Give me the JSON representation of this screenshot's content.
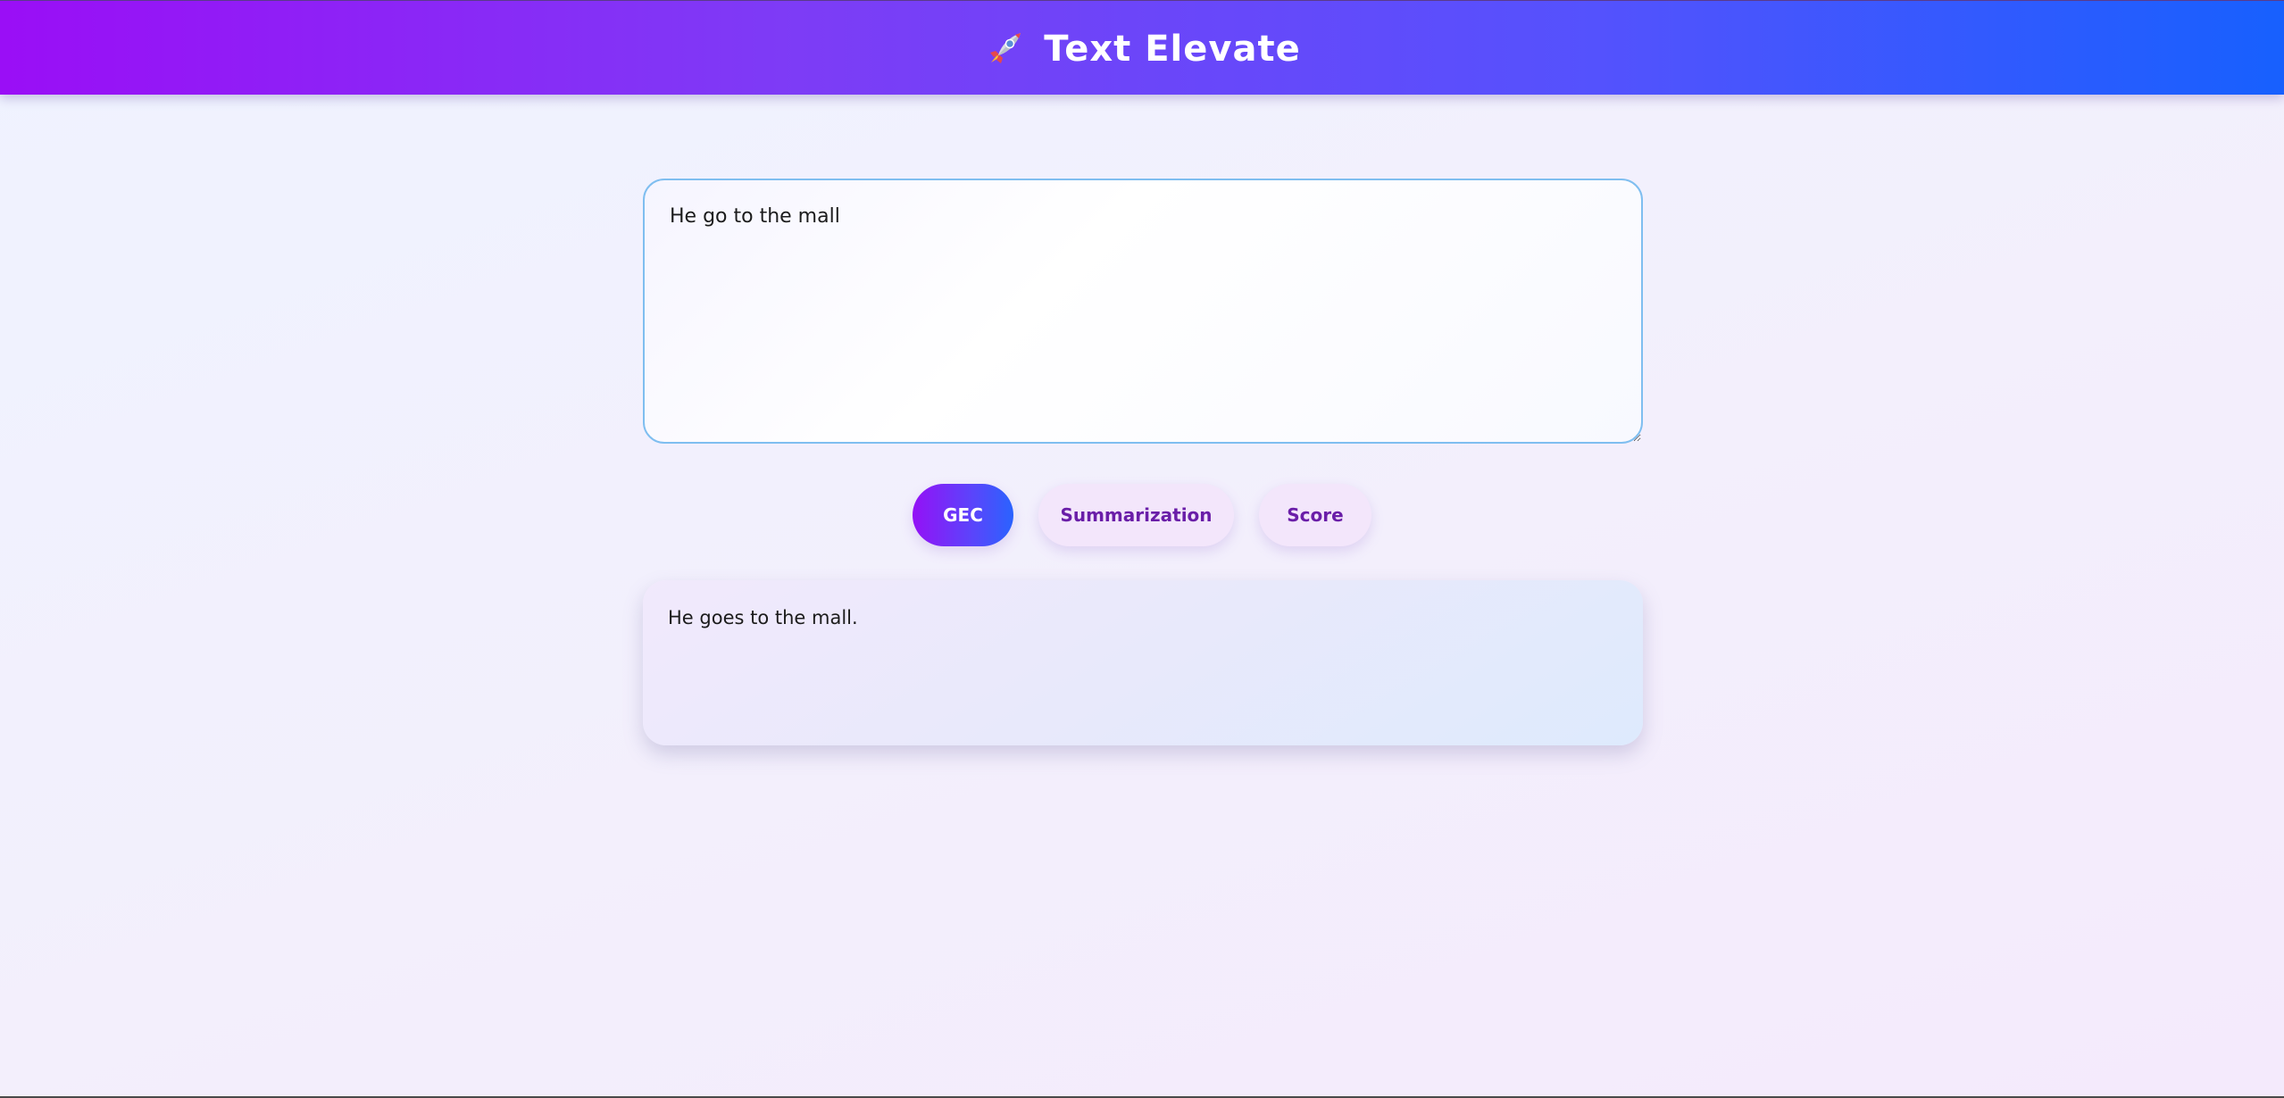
{
  "header": {
    "title": "Text Elevate",
    "icon": "rocket-icon"
  },
  "editor": {
    "value": "He go to the mall"
  },
  "actions": {
    "gec_label": "GEC",
    "summarization_label": "Summarization",
    "score_label": "Score",
    "active": "GEC"
  },
  "result": {
    "text": "He goes to the mall."
  },
  "colors": {
    "header_gradient_start": "#9a0ef6",
    "header_gradient_end": "#1760fe",
    "button_accent_text": "#6a1ea8",
    "editor_border": "#7fbef0"
  }
}
